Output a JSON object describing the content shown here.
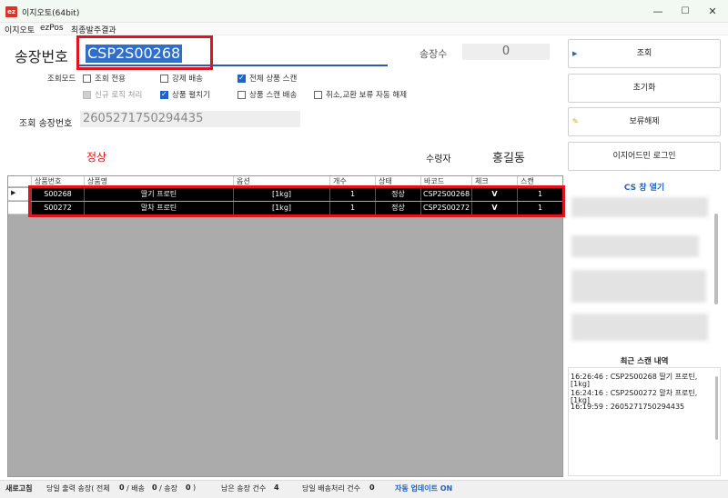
{
  "window": {
    "app_icon": "ez",
    "title": "이지오토(64bit)",
    "controls": [
      "—",
      "☐",
      "✕"
    ]
  },
  "menu": [
    "이지오토",
    "ezPos",
    "최종발주결과"
  ],
  "form": {
    "invoice_label": "송장번호",
    "invoice_value": "CSP2S00268",
    "count_label": "송장수",
    "count_value": "0",
    "mode_label": "조회모드",
    "options": [
      {
        "label": "조회 전용",
        "checked": false,
        "disabled": false
      },
      {
        "label": "강제 배송",
        "checked": false,
        "disabled": false
      },
      {
        "label": "전체 상품 스캔",
        "checked": true,
        "disabled": false
      },
      {
        "label": "신규 로직 처리",
        "checked": false,
        "disabled": true
      },
      {
        "label": "상품 펼치기",
        "checked": true,
        "disabled": false
      },
      {
        "label": "상품 스캔 배송",
        "checked": false,
        "disabled": false
      },
      {
        "label": "취소,교환 보류 자동 해제",
        "checked": false,
        "disabled": false
      }
    ],
    "searched_label": "조회 송장번호",
    "searched_value": "2605271750294435",
    "status_text": "정상",
    "receiver_label": "수령자",
    "receiver_value": "홍길동"
  },
  "grid": {
    "columns": [
      "상품번호",
      "상품명",
      "옵션",
      "개수",
      "상태",
      "바코드",
      "체크",
      "스캔"
    ],
    "rows": [
      [
        "S00268",
        "딸기 프로틴",
        "[1kg]",
        "1",
        "정상",
        "CSP2S00268",
        "V",
        "1"
      ],
      [
        "S00272",
        "말차 프로틴",
        "[1kg]",
        "1",
        "정상",
        "CSP2S00272",
        "V",
        "1"
      ]
    ]
  },
  "sidebar": {
    "buttons": [
      {
        "label": "조회",
        "icon": "play-arrow-icon"
      },
      {
        "label": "초기화",
        "icon": ""
      },
      {
        "label": "보류해제",
        "icon": "key-icon"
      },
      {
        "label": "이지어드민 로그인",
        "icon": ""
      }
    ],
    "cs_title": "CS 창 열기",
    "recent_title": "최근 스캔 내역",
    "recent_lines": [
      "16:26:46 : CSP2S00268 딸기 프로틴,",
      "[1kg]",
      "16:24:16 : CSP2S00272 말차 프로틴,",
      "[1kg]",
      "16:19:59 : 2605271750294435"
    ]
  },
  "status": {
    "refresh": "새로고침",
    "today_output": "당일 출력 송장( 전체",
    "total": "0",
    "delivery_sep": "/ 배송",
    "delivery": "0",
    "invoice_sep": "/ 송장",
    "invoice": "0",
    "close_paren": ")",
    "remaining_label": "남은 송장 건수",
    "remaining": "4",
    "processed_label": "당일 배송처리 건수",
    "processed": "0",
    "auto_update": "자동 업데이트 ON"
  },
  "colors": {
    "highlight_red": "#e0141c",
    "accent_blue": "#1e63c9",
    "status_red": "#e0141c"
  }
}
